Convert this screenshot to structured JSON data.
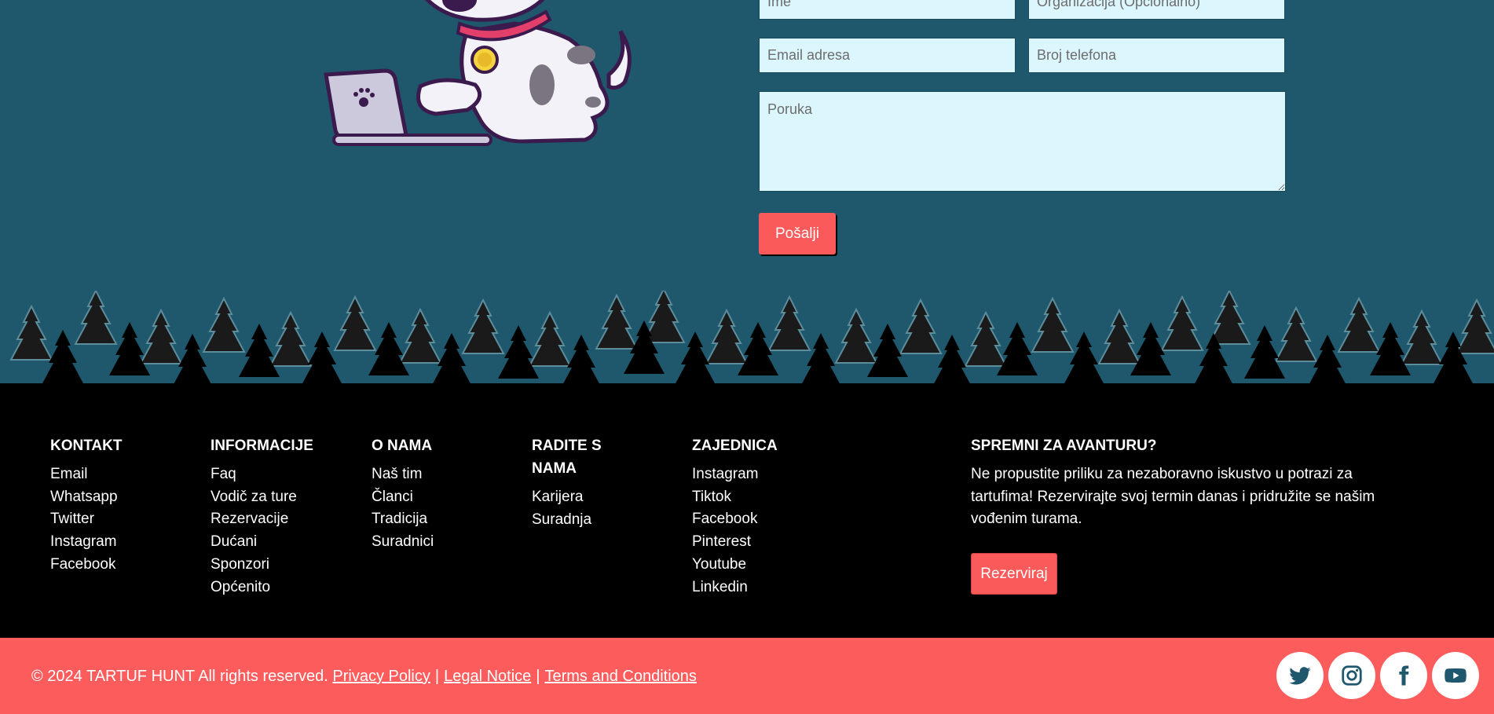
{
  "form": {
    "name_placeholder": "Ime",
    "org_placeholder": "Organizacija (Opcionalno)",
    "email_placeholder": "Email adresa",
    "phone_placeholder": "Broj telefona",
    "message_placeholder": "Poruka",
    "submit_label": "Pošalji"
  },
  "footer": {
    "columns": [
      {
        "title": "KONTAKT",
        "items": [
          "Email",
          "Whatsapp",
          "Twitter",
          "Instagram",
          "Facebook"
        ]
      },
      {
        "title": "INFORMACIJE",
        "items": [
          "Faq",
          "Vodič za ture",
          "Rezervacije",
          "Dućani",
          "Sponzori",
          "Općenito"
        ]
      },
      {
        "title": "O NAMA",
        "items": [
          "Naš tim",
          "Članci",
          "Tradicija",
          "Suradnici"
        ]
      },
      {
        "title": "RADITE S NAMA",
        "items": [
          "Karijera",
          "Suradnja"
        ]
      },
      {
        "title": "ZAJEDNICA",
        "items": [
          "Instagram",
          "Tiktok",
          "Facebook",
          "Pinterest",
          "Youtube",
          "Linkedin"
        ]
      }
    ],
    "cta": {
      "title": "SPREMNI ZA AVANTURU?",
      "text": "Ne propustite priliku za nezaboravno iskustvo u potrazi za tartufima! Rezervirajte svoj termin danas i pridružite se našim vođenim turama.",
      "button_label": "Rezerviraj"
    }
  },
  "bottom_bar": {
    "copyright": "© 2024 TARTUF HUNT All rights reserved.",
    "privacy": "Privacy Policy",
    "separator": "|",
    "legal": "Legal Notice",
    "terms": "Terms and Conditions",
    "social_icons": [
      "twitter-icon",
      "instagram-icon",
      "facebook-icon",
      "youtube-icon"
    ]
  },
  "colors": {
    "header_bg": "#1f586c",
    "field_bg": "#dcf6fd",
    "accent": "#fd5c5c",
    "footer_bg": "#000000",
    "social_icon": "#1f586c"
  }
}
